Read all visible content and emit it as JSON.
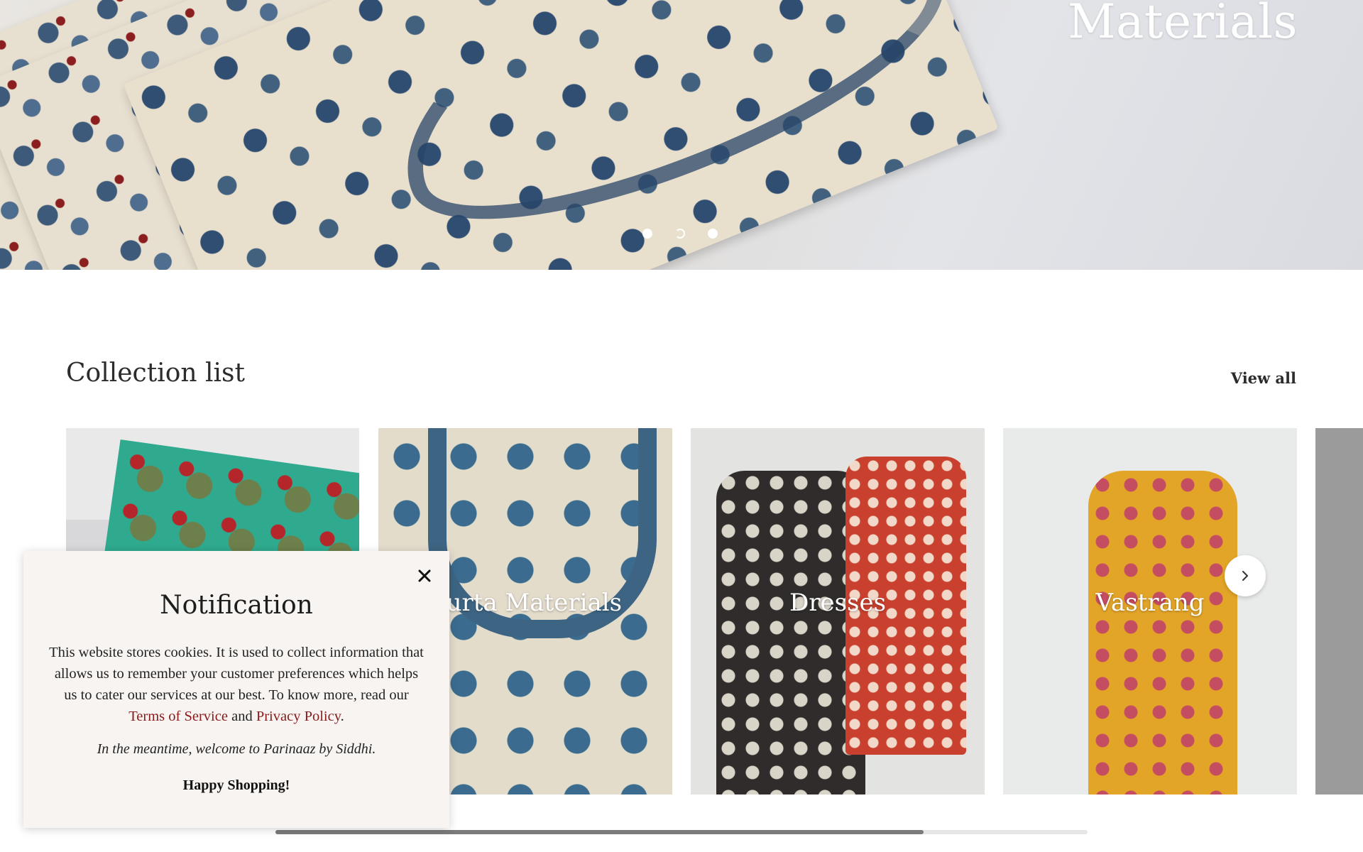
{
  "hero": {
    "title": "Materials",
    "slides": [
      {
        "state": "inactive"
      },
      {
        "state": "active"
      },
      {
        "state": "inactive"
      }
    ]
  },
  "collection": {
    "title": "Collection list",
    "view_all": "View all",
    "cards": [
      {
        "label": ""
      },
      {
        "label": "Kurta Materials"
      },
      {
        "label": "Dresses"
      },
      {
        "label": "Vastrang"
      },
      {
        "label": ""
      }
    ],
    "next_icon": "chevron-right-icon"
  },
  "notification": {
    "title": "Notification",
    "body_text": "This website stores cookies. It is used to collect information that allows us to remember your customer preferences which helps us to cater our services at our best. To know more, read our",
    "terms_link": "Terms of Service",
    "and_text": "and",
    "privacy_link": "Privacy Policy",
    "period": ".",
    "welcome": "In the meantime, welcome to Parinaaz by Siddhi.",
    "closing": "Happy Shopping!",
    "link_color": "#8a1a1a"
  }
}
